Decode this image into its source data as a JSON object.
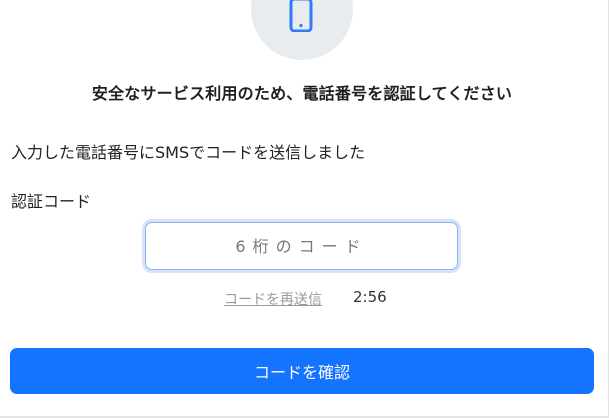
{
  "header": {
    "icon": "smartphone-icon",
    "title": "安全なサービス利用のため、電話番号を認証してください"
  },
  "body": {
    "info_text": "入力した電話番号にSMSでコードを送信しました",
    "code_label": "認証コード"
  },
  "code_input": {
    "value": "",
    "placeholder": "6桁のコード"
  },
  "resend": {
    "link_label": "コードを再送信",
    "timer": "2:56"
  },
  "confirm_button": {
    "label": "コードを確認"
  },
  "colors": {
    "accent": "#1473ff",
    "icon": "#2d7cf6",
    "circle_bg": "#e9ecef",
    "disabled_link": "#9a9a9a"
  }
}
